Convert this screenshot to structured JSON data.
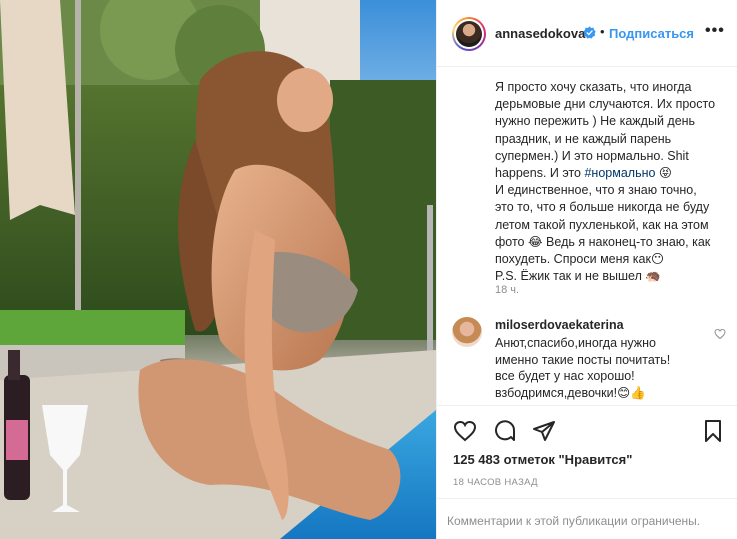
{
  "post": {
    "username": "annasedokova",
    "follow_label": "Подписаться",
    "separator": "•",
    "more_label": "•••",
    "caption_lines": [
      "Я просто хочу сказать, что иногда",
      "дерьмовые дни случаются. Их просто",
      "нужно пережить ) Не каждый день",
      "праздник, и не каждый парень",
      "супермен.) И это нормально. Shit",
      "happens. И это ",
      "И единственное, что я знаю точно,",
      "это то, что я больше никогда не буду",
      "летом такой пухленькой, как на этом",
      "фото 😂 Ведь я наконец-то знаю, как",
      "похудеть. Спроси меня как😶",
      "P.S. Ёжик так и не вышел 🦔"
    ],
    "hashtag": "#нормально",
    "hashtag_suffix": " 😝",
    "caption_time": "18 ч.",
    "comment": {
      "username": "miloserdovaekaterina",
      "lines": [
        "Анют,спасибо,иногда нужно",
        "именно такие посты почитать!",
        "все будет у нас хорошо!",
        "взбодримся,девочки!😊👍"
      ]
    },
    "likes": "125 483 отметок \"Нравится\"",
    "post_time": "18 ЧАСОВ НАЗАД",
    "comments_restricted": "Комментарии к этой публикации ограничены."
  },
  "icons": {
    "verified": "verified-badge-icon",
    "like": "heart-icon",
    "comment": "comment-bubble-icon",
    "share": "paper-plane-icon",
    "save": "bookmark-icon"
  },
  "colors": {
    "link_blue": "#3897f0",
    "hashtag": "#00376b",
    "muted": "#8e8e8e",
    "text": "#262626"
  }
}
